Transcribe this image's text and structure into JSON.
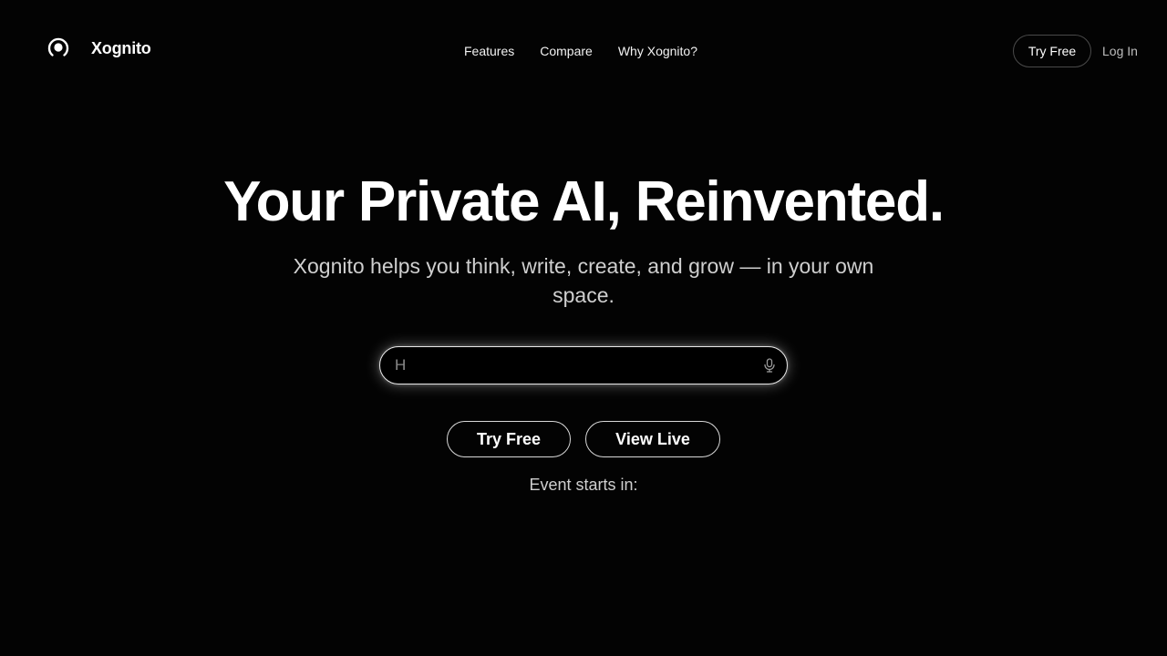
{
  "brand": {
    "name": "Xognito",
    "logo_icon": "ring-dot-icon"
  },
  "nav": {
    "items": [
      {
        "label": "Features"
      },
      {
        "label": "Compare"
      },
      {
        "label": "Why Xognito?"
      }
    ]
  },
  "header_actions": {
    "try_label": "Try Free",
    "login_label": "Log In"
  },
  "hero": {
    "title": "Your Private AI, Reinvented.",
    "subtitle": "Xognito helps you think, write, create, and grow — in your own space."
  },
  "prompt": {
    "placeholder": "H",
    "value": "",
    "mic_icon": "microphone-icon"
  },
  "cta": {
    "try_label": "Try Free",
    "live_label": "View Live"
  },
  "event": {
    "label": "Event starts in:"
  },
  "colors": {
    "background": "#030303",
    "text": "#ffffff",
    "muted": "#cfcfcf"
  }
}
